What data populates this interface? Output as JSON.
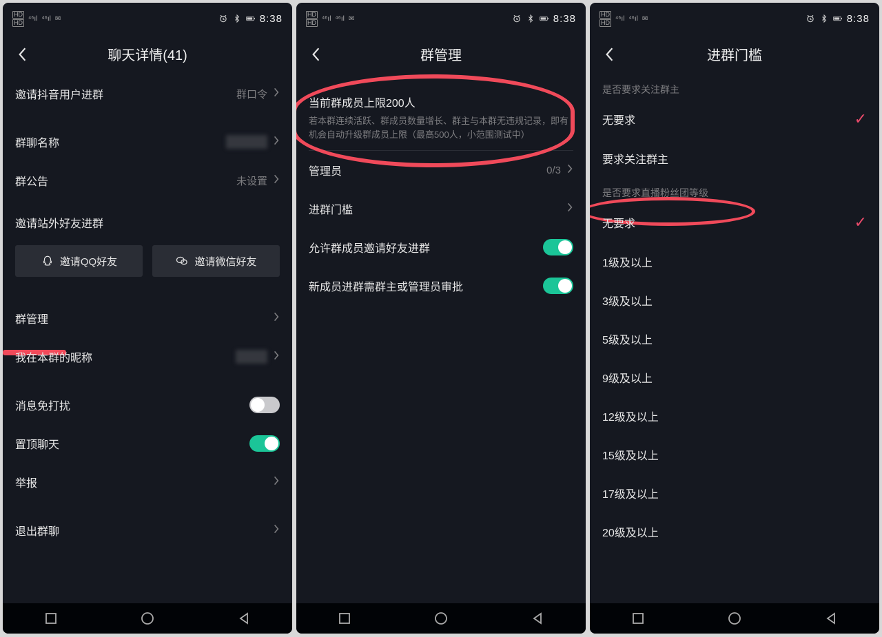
{
  "status": {
    "hd": "HD",
    "sig1": "⁴⁶ıl",
    "sig2": "⁴⁶ıl",
    "alarm": "⏰",
    "bt": "✱",
    "batt": "▮▯",
    "time": "8:38"
  },
  "screen1": {
    "title": "聊天详情(41)",
    "invite_users": "邀请抖音用户进群",
    "invite_users_right": "群口令",
    "group_name_label": "群聊名称",
    "announcement_label": "群公告",
    "announcement_value": "未设置",
    "invite_outside_label": "邀请站外好友进群",
    "btn_qq": "邀请QQ好友",
    "btn_wechat": "邀请微信好友",
    "manage_label": "群管理",
    "nickname_label": "我在本群的昵称",
    "mute_label": "消息免打扰",
    "pin_label": "置顶聊天",
    "report_label": "举报",
    "leave_label": "退出群聊"
  },
  "screen2": {
    "title": "群管理",
    "limit_head": "当前群成员上限200人",
    "limit_desc": "若本群连续活跃、群成员数量增长、群主与本群无违规记录，即有机会自动升级群成员上限（最高500人，小范围测试中）",
    "admins_label": "管理员",
    "admins_value": "0/3",
    "threshold_label": "进群门槛",
    "allow_invite_label": "允许群成员邀请好友进群",
    "approve_label": "新成员进群需群主或管理员审批"
  },
  "screen3": {
    "title": "进群门槛",
    "section_follow": "是否要求关注群主",
    "opt_none": "无要求",
    "opt_follow": "要求关注群主",
    "section_fan": "是否要求直播粉丝团等级",
    "levels": [
      "无要求",
      "1级及以上",
      "3级及以上",
      "5级及以上",
      "9级及以上",
      "12级及以上",
      "15级及以上",
      "17级及以上",
      "20级及以上"
    ]
  }
}
